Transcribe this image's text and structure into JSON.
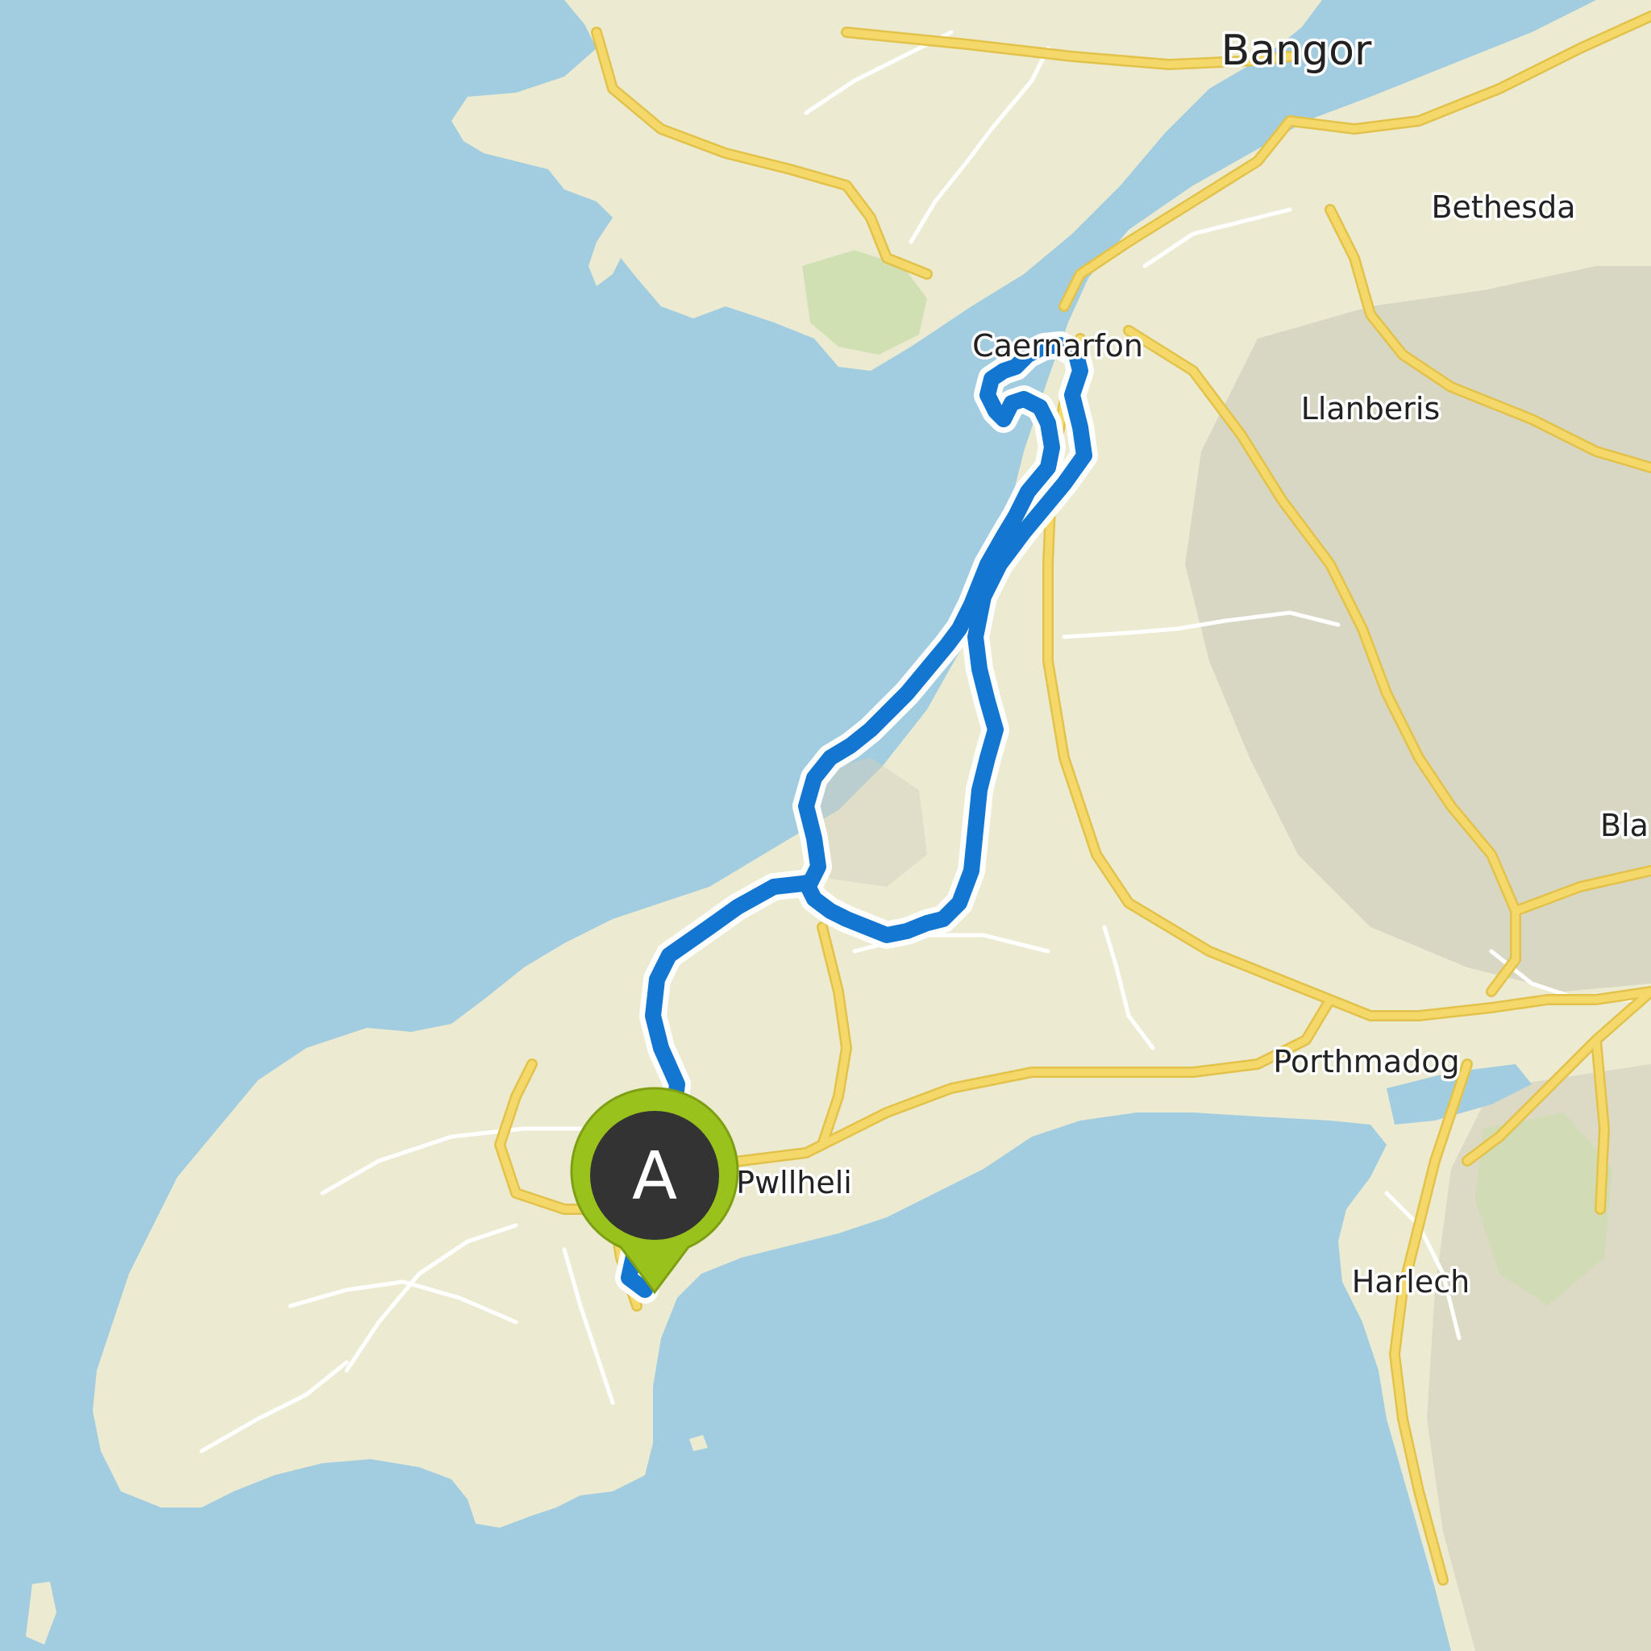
{
  "map": {
    "colors": {
      "water": "#a2cde0",
      "land": "#ecebd2",
      "forest": "#c8dca8",
      "hill_shade": "#c9c6b6",
      "road_major": "#f4d96a",
      "road_major_casing": "#e2c24a",
      "road_minor": "#ffffff",
      "route": "#1376d1",
      "route_outline": "#ffffff",
      "marker_fill": "#99c21c",
      "marker_inner": "#333333"
    },
    "places": [
      {
        "id": "bangor",
        "name": "Bangor"
      },
      {
        "id": "bethesda",
        "name": "Bethesda"
      },
      {
        "id": "caernarfon",
        "name": "Caernarfon"
      },
      {
        "id": "llanberis",
        "name": "Llanberis"
      },
      {
        "id": "bla",
        "name": "Bla"
      },
      {
        "id": "porthmadog",
        "name": "Porthmadog"
      },
      {
        "id": "pwllheli",
        "name": "Pwllheli"
      },
      {
        "id": "harlech",
        "name": "Harlech"
      }
    ],
    "start_marker": {
      "letter": "A",
      "icon": "map-pin-icon"
    }
  }
}
